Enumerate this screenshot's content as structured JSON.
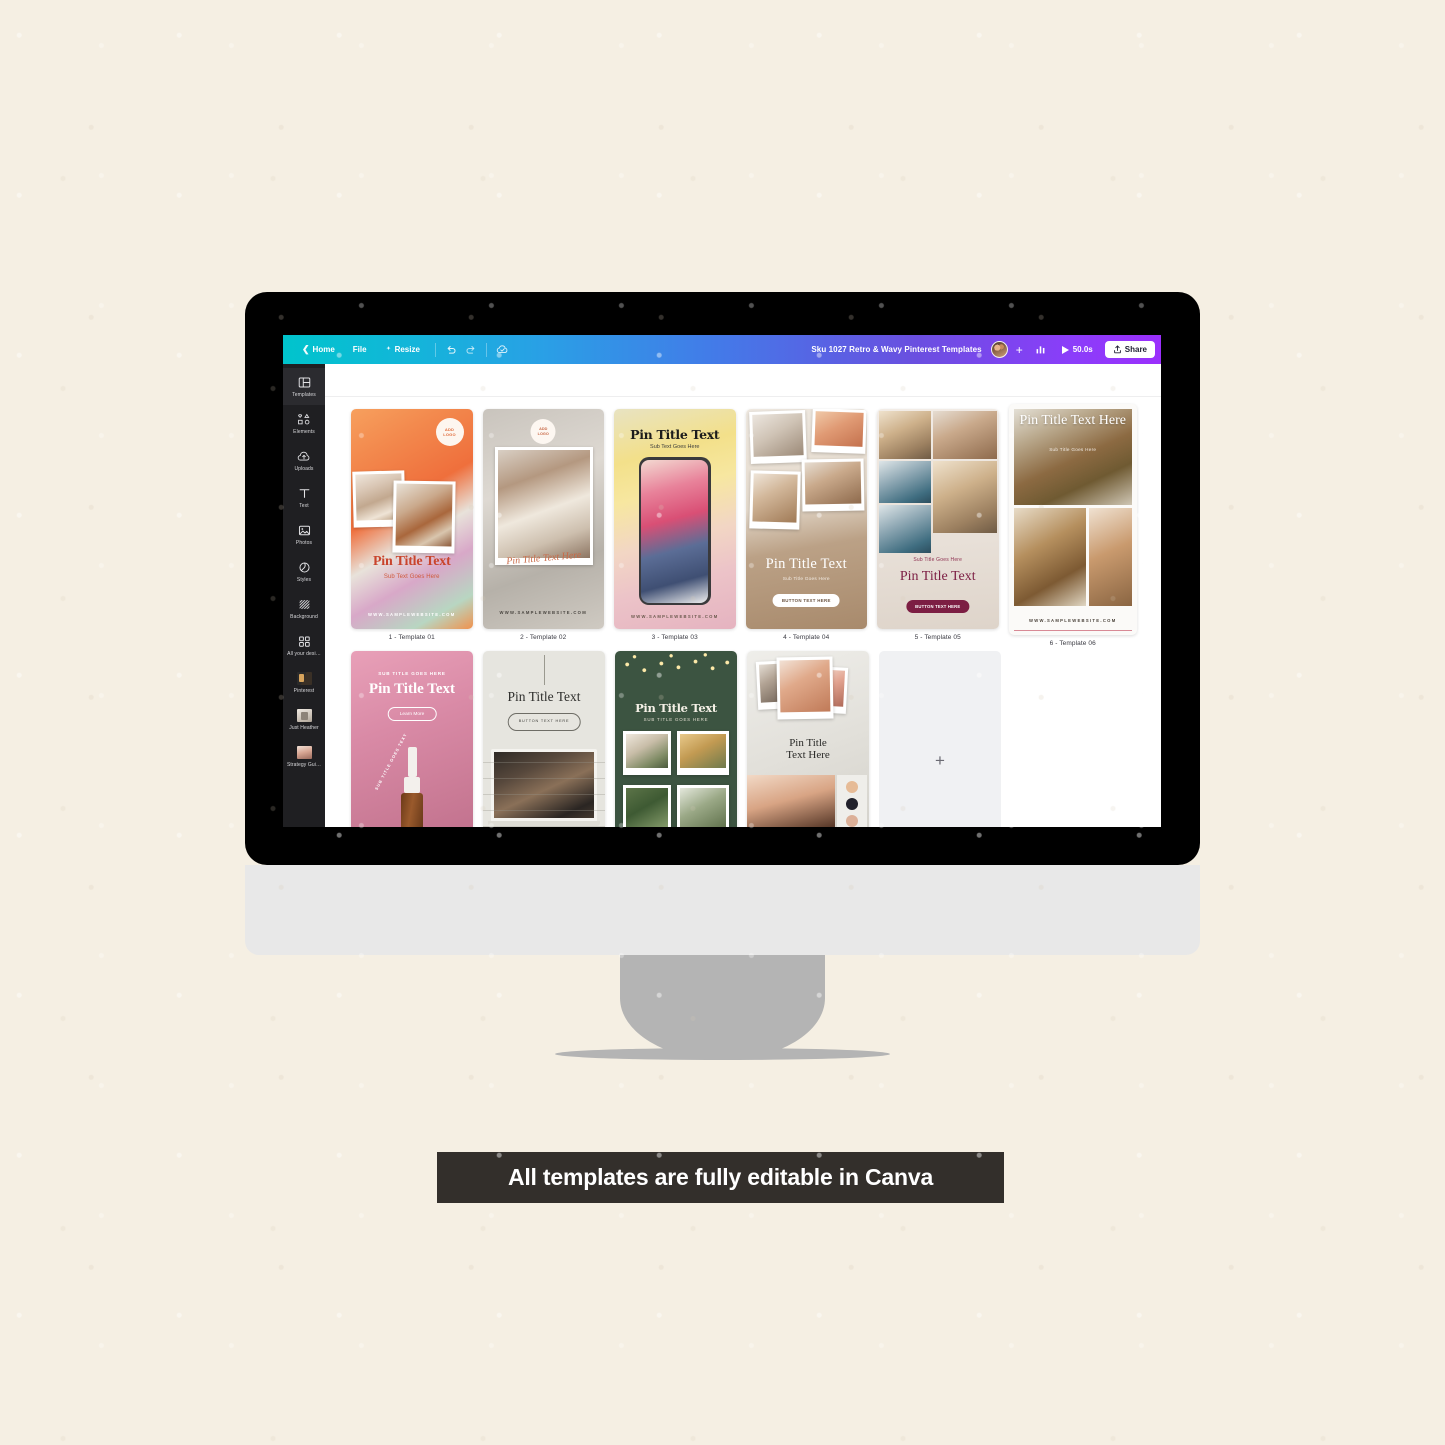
{
  "page": {
    "background_color": "#f5efe3",
    "caption": "All templates are fully editable in Canva"
  },
  "app": {
    "toolbar": {
      "home_label": "Home",
      "file_label": "File",
      "resize_label": "Resize",
      "undo_icon": "undo-arrow-icon",
      "redo_icon": "redo-arrow-icon",
      "cloud_icon": "cloud-saved-icon",
      "document_title": "Sku 1027 Retro & Wavy Pinterest Templates",
      "avatar_icon": "user-avatar",
      "add_collaborator_label": "+",
      "analytics_icon": "bar-chart-icon",
      "play_icon": "play-triangle-icon",
      "duration_label": "50.0s",
      "share_icon": "share-upload-icon",
      "share_label": "Share",
      "gradient_start": "#00c4cc",
      "gradient_end": "#9b2ffc"
    },
    "sidebar": {
      "items": [
        {
          "label": "Templates",
          "icon": "templates-grid-icon",
          "active": true
        },
        {
          "label": "Elements",
          "icon": "elements-shapes-icon",
          "active": false
        },
        {
          "label": "Uploads",
          "icon": "upload-cloud-icon",
          "active": false
        },
        {
          "label": "Text",
          "icon": "text-t-icon",
          "active": false
        },
        {
          "label": "Photos",
          "icon": "photo-image-icon",
          "active": false
        },
        {
          "label": "Styles",
          "icon": "styles-palette-icon",
          "active": false
        },
        {
          "label": "Background",
          "icon": "background-hatch-icon",
          "active": false
        },
        {
          "label": "All your desi…",
          "icon": "all-designs-grid-icon",
          "active": false
        },
        {
          "label": "Pinterest",
          "icon": "pinterest-thumb-icon",
          "active": false
        },
        {
          "label": "Just Heather",
          "icon": "just-heather-thumb-icon",
          "active": false
        },
        {
          "label": "Strategy Gui…",
          "icon": "strategy-guide-thumb-icon",
          "active": false
        }
      ]
    },
    "canvas": {
      "add_page_label": "+",
      "rows": [
        [
          {
            "label": "1 - Template 01",
            "style": "t1",
            "selected": false,
            "texts": {
              "logo": "ADD\nLOGO",
              "title": "Pin Title Text",
              "subtitle": "Sub Text Goes Here",
              "website": "WWW.SAMPLEWEBSITE.COM"
            }
          },
          {
            "label": "2 - Template 02",
            "style": "t2",
            "selected": false,
            "texts": {
              "logo": "ADD\nLOGO",
              "title": "Pin Title Text Here",
              "website": "WWW.SAMPLEWEBSITE.COM"
            }
          },
          {
            "label": "3 - Template 03",
            "style": "t3",
            "selected": false,
            "texts": {
              "title": "Pin Title Text",
              "subtitle": "Sub Text Goes Here",
              "website": "WWW.SAMPLEWEBSITE.COM"
            }
          },
          {
            "label": "4 - Template 04",
            "style": "t4",
            "selected": false,
            "texts": {
              "title": "Pin Title Text",
              "subtitle": "Sub Title Goes Here",
              "button": "BUTTON TEXT HERE"
            }
          },
          {
            "label": "5 - Template 05",
            "style": "t5",
            "selected": false,
            "texts": {
              "subtitle": "Sub Title Goes Here",
              "title": "Pin Title Text",
              "button": "BUTTON TEXT HERE"
            }
          },
          {
            "label": "6 - Template 06",
            "style": "t6",
            "selected": true,
            "texts": {
              "title": "Pin Title Text Here",
              "subtitle": "Sub Title Goes Here",
              "website": "WWW.SAMPLEWEBSITE.COM"
            }
          }
        ],
        [
          {
            "label": "",
            "style": "t7",
            "selected": false,
            "texts": {
              "subtitle": "SUB TITLE GOES HERE",
              "title": "Pin Title Text",
              "button": "Learn More",
              "circle_text": "SUB TITLE GOES TEXT"
            }
          },
          {
            "label": "",
            "style": "t8",
            "selected": false,
            "texts": {
              "title": "Pin Title Text",
              "button": "BUTTON TEXT HERE"
            }
          },
          {
            "label": "",
            "style": "t9",
            "selected": false,
            "texts": {
              "title": "Pin Title Text",
              "subtitle": "SUB TITLE GOES HERE"
            }
          },
          {
            "label": "",
            "style": "t10",
            "selected": false,
            "texts": {
              "title": "Pin Title\nText Here"
            }
          }
        ]
      ]
    }
  }
}
